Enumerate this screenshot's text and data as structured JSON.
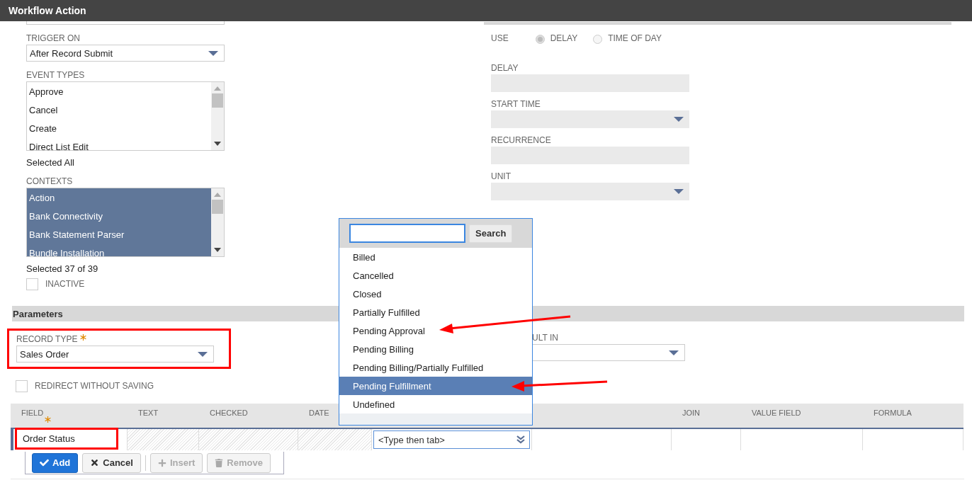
{
  "window": {
    "title": "Workflow Action"
  },
  "trigger_on": {
    "label": "TRIGGER ON",
    "value": "After Record Submit"
  },
  "event_types": {
    "label": "EVENT TYPES",
    "items": [
      {
        "label": "Approve",
        "selected": false
      },
      {
        "label": "Cancel",
        "selected": false
      },
      {
        "label": "Create",
        "selected": false
      },
      {
        "label": "Direct List Edit",
        "selected": false
      }
    ],
    "summary": "Selected All"
  },
  "contexts": {
    "label": "CONTEXTS",
    "items": [
      {
        "label": "Action",
        "selected": true
      },
      {
        "label": "Bank Connectivity",
        "selected": true
      },
      {
        "label": "Bank Statement Parser",
        "selected": true
      },
      {
        "label": "Bundle Installation",
        "selected": true
      }
    ],
    "summary": "Selected 37 of 39"
  },
  "inactive": {
    "label": "INACTIVE",
    "checked": false
  },
  "use": {
    "label": "USE",
    "options": [
      {
        "label": "DELAY",
        "selected": true
      },
      {
        "label": "TIME OF DAY",
        "selected": false
      }
    ]
  },
  "schedule_fields": [
    {
      "label": "DELAY",
      "kind": "text"
    },
    {
      "label": "START TIME",
      "kind": "select"
    },
    {
      "label": "RECURRENCE",
      "kind": "text"
    },
    {
      "label": "UNIT",
      "kind": "select"
    }
  ],
  "parameters": {
    "title": "Parameters",
    "record_type": {
      "label": "RECORD TYPE",
      "required": true,
      "value": "Sales Order"
    },
    "result_in": {
      "label": "ULT IN"
    },
    "redirect": {
      "label": "REDIRECT WITHOUT SAVING",
      "checked": false
    }
  },
  "table": {
    "columns": [
      {
        "label": "FIELD",
        "required": true
      },
      {
        "label": "TEXT"
      },
      {
        "label": "CHECKED"
      },
      {
        "label": "DATE"
      },
      {},
      {},
      {
        "label": "JOIN"
      },
      {
        "label": "VALUE FIELD"
      },
      {
        "label": "FORMULA"
      }
    ],
    "row": [
      {
        "kind": "text",
        "value": "Order Status"
      },
      {
        "kind": "hatched"
      },
      {
        "kind": "hatched"
      },
      {
        "kind": "hatched"
      },
      {
        "kind": "combo",
        "placeholder": "<Type then tab>"
      },
      {
        "kind": "empty"
      },
      {
        "kind": "empty"
      },
      {
        "kind": "empty"
      },
      {
        "kind": "empty"
      }
    ],
    "buttons": [
      {
        "label": "Add",
        "kind": "primary",
        "disabled": false
      },
      {
        "label": "Cancel",
        "kind": "cancel",
        "disabled": false
      },
      {
        "label": "Insert",
        "kind": "insert",
        "disabled": true
      },
      {
        "label": "Remove",
        "kind": "remove",
        "disabled": true
      }
    ]
  },
  "popup": {
    "search_button": "Search",
    "items": [
      {
        "label": "Billed",
        "selected": false
      },
      {
        "label": "Cancelled",
        "selected": false
      },
      {
        "label": "Closed",
        "selected": false
      },
      {
        "label": "Partially Fulfilled",
        "selected": false
      },
      {
        "label": "Pending Approval",
        "selected": false
      },
      {
        "label": "Pending Billing",
        "selected": false
      },
      {
        "label": "Pending Billing/Partially Fulfilled",
        "selected": false
      },
      {
        "label": "Pending Fulfillment",
        "selected": true
      },
      {
        "label": "Undefined",
        "selected": false
      }
    ]
  }
}
